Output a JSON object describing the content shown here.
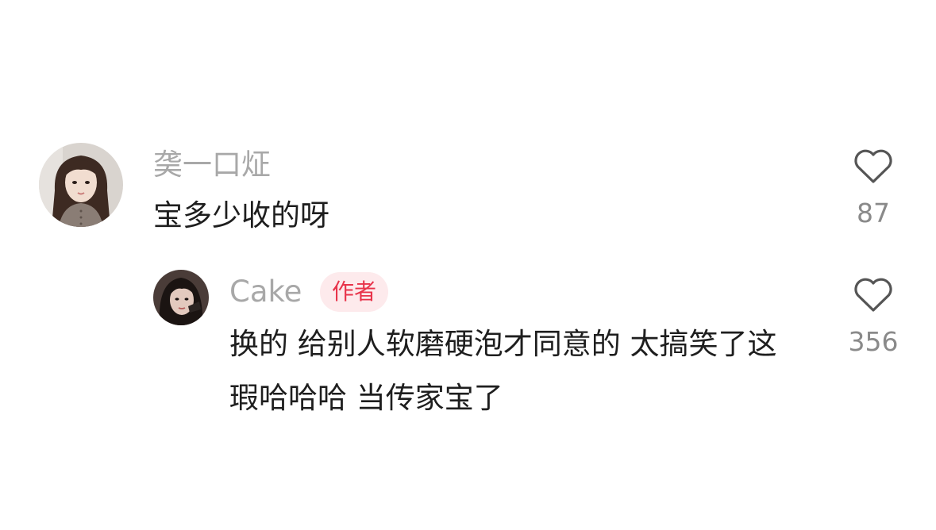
{
  "comments": [
    {
      "username": "䶮一口炡",
      "text": "宝多少收的呀",
      "like_count": "87",
      "avatar_icon": "user-avatar-woman-long-hair"
    }
  ],
  "reply": {
    "username": "Cake",
    "badge": "作者",
    "text": "换的 给别人软磨硬泡才同意的 太搞笑了这瑕哈哈哈 当传家宝了",
    "like_count": "356",
    "avatar_icon": "author-avatar-woman-dark"
  },
  "icons": {
    "like": "heart-outline-icon"
  },
  "colors": {
    "username": "#a8a8a8",
    "text": "#1e1e1e",
    "count": "#8a8a8a",
    "badge_bg": "#fdeaec",
    "badge_text": "#e8334a",
    "heart_stroke": "#555555"
  }
}
